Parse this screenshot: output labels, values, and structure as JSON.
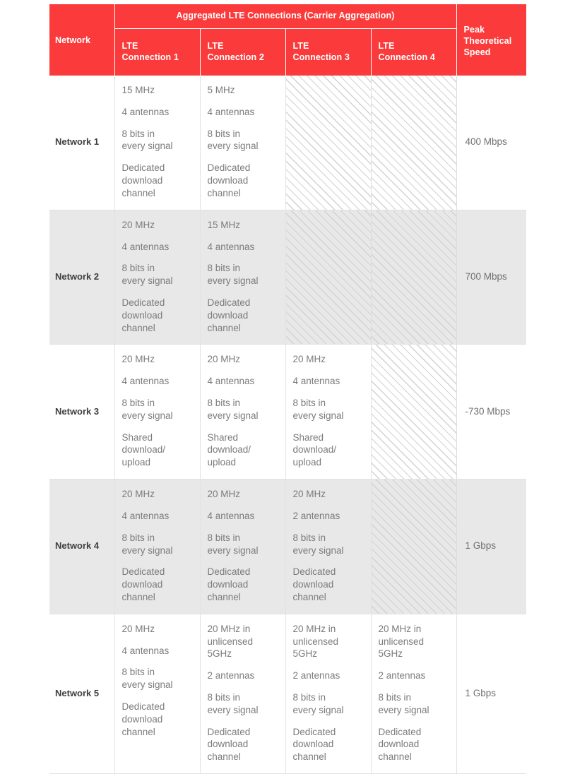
{
  "table": {
    "header": {
      "network_label": "Network",
      "group_label": "Aggregated LTE Connections (Carrier Aggregation)",
      "connection_labels": [
        "LTE\nConnection 1",
        "LTE\nConnection 2",
        "LTE\nConnection 3",
        "LTE\nConnection 4"
      ],
      "connection_1_line1": "LTE",
      "connection_1_line2": "Connection 1",
      "connection_2_line1": "LTE",
      "connection_2_line2": "Connection 2",
      "connection_3_line1": "LTE",
      "connection_3_line2": "Connection 3",
      "connection_4_line1": "LTE",
      "connection_4_line2": "Connection 4",
      "peak_line1": "Peak",
      "peak_line2": "Theoretical",
      "peak_line3": "Speed"
    },
    "colors": {
      "header_red": "#fb3b3b",
      "header_text": "#ffffff",
      "row_shaded": "#e8e8e8",
      "row_plain": "#ffffff",
      "body_text": "#7b7b7e",
      "label_text": "#3f3f42",
      "grid_line": "#e2e2e2",
      "hatch_line": "#d2d2d2"
    },
    "rows": [
      {
        "name": "Network 1",
        "shaded": false,
        "peak_speed": "400 Mbps",
        "connections": [
          {
            "empty": false,
            "bandwidth": "15 MHz",
            "antennas": "4 antennas",
            "bits": "8 bits in\never",
            "bits_line1": "8 bits in",
            "bits_line2": "every signal",
            "channel_line1": "Dedicated",
            "channel_line2": "download",
            "channel_line3": "channel"
          },
          {
            "empty": false,
            "bandwidth": "5 MHz",
            "antennas": "4 antennas",
            "bits_line1": "8 bits in",
            "bits_line2": "every signal",
            "channel_line1": "Dedicated",
            "channel_line2": "download",
            "channel_line3": "channel"
          },
          {
            "empty": true
          },
          {
            "empty": true
          }
        ]
      },
      {
        "name": "Network 2",
        "shaded": true,
        "peak_speed": "700 Mbps",
        "connections": [
          {
            "empty": false,
            "bandwidth": "20 MHz",
            "antennas": "4 antennas",
            "bits_line1": "8 bits in",
            "bits_line2": "every signal",
            "channel_line1": "Dedicated",
            "channel_line2": "download",
            "channel_line3": "channel"
          },
          {
            "empty": false,
            "bandwidth": "15 MHz",
            "antennas": "4 antennas",
            "bits_line1": "8 bits in",
            "bits_line2": "every signal",
            "channel_line1": "Dedicated",
            "channel_line2": "download",
            "channel_line3": "channel"
          },
          {
            "empty": true
          },
          {
            "empty": true
          }
        ]
      },
      {
        "name": "Network 3",
        "shaded": false,
        "peak_speed": "-730 Mbps",
        "connections": [
          {
            "empty": false,
            "bandwidth": "20 MHz",
            "antennas": "4 antennas",
            "bits_line1": "8 bits in",
            "bits_line2": "every signal",
            "channel_line1": "Shared",
            "channel_line2": "download/",
            "channel_line3": "upload"
          },
          {
            "empty": false,
            "bandwidth": "20 MHz",
            "antennas": "4 antennas",
            "bits_line1": "8 bits in",
            "bits_line2": "every signal",
            "channel_line1": "Shared",
            "channel_line2": "download/",
            "channel_line3": "upload"
          },
          {
            "empty": false,
            "bandwidth": "20 MHz",
            "antennas": "4 antennas",
            "bits_line1": "8 bits in",
            "bits_line2": "every signal",
            "channel_line1": "Shared",
            "channel_line2": "download/",
            "channel_line3": "upload"
          },
          {
            "empty": true
          }
        ]
      },
      {
        "name": "Network 4",
        "shaded": true,
        "peak_speed": "1 Gbps",
        "connections": [
          {
            "empty": false,
            "bandwidth": "20 MHz",
            "antennas": "4 antennas",
            "bits_line1": "8 bits in",
            "bits_line2": "every signal",
            "channel_line1": "Dedicated",
            "channel_line2": "download",
            "channel_line3": "channel"
          },
          {
            "empty": false,
            "bandwidth": "20 MHz",
            "antennas": "4 antennas",
            "bits_line1": "8 bits in",
            "bits_line2": "every signal",
            "channel_line1": "Dedicated",
            "channel_line2": "download",
            "channel_line3": "channel"
          },
          {
            "empty": false,
            "bandwidth": "20 MHz",
            "antennas": "2 antennas",
            "bits_line1": "8 bits in",
            "bits_line2": "every signal",
            "channel_line1": "Dedicated",
            "channel_line2": "download",
            "channel_line3": "channel"
          },
          {
            "empty": true
          }
        ]
      },
      {
        "name": "Network 5",
        "shaded": false,
        "peak_speed": "1 Gbps",
        "connections": [
          {
            "empty": false,
            "bandwidth": "20 MHz",
            "antennas": "4 antennas",
            "bits_line1": "8 bits in",
            "bits_line2": "every signal",
            "channel_line1": "Dedicated",
            "channel_line2": "download",
            "channel_line3": "channel"
          },
          {
            "empty": false,
            "bandwidth_line1": "20 MHz in",
            "bandwidth_line2": "unlicensed",
            "bandwidth_line3": "5GHz",
            "antennas": "2 antennas",
            "bits_line1": "8 bits in",
            "bits_line2": "every signal",
            "channel_line1": "Dedicated",
            "channel_line2": "download",
            "channel_line3": "channel"
          },
          {
            "empty": false,
            "bandwidth_line1": "20 MHz in",
            "bandwidth_line2": "unlicensed",
            "bandwidth_line3": "5GHz",
            "antennas": "2 antennas",
            "bits_line1": "8 bits in",
            "bits_line2": "every signal",
            "channel_line1": "Dedicated",
            "channel_line2": "download",
            "channel_line3": "channel"
          },
          {
            "empty": false,
            "bandwidth_line1": "20 MHz in",
            "bandwidth_line2": "unlicensed",
            "bandwidth_line3": "5GHz",
            "antennas": "2 antennas",
            "bits_line1": "8 bits in",
            "bits_line2": "every signal",
            "channel_line1": "Dedicated",
            "channel_line2": "download",
            "channel_line3": "channel"
          }
        ]
      }
    ]
  }
}
